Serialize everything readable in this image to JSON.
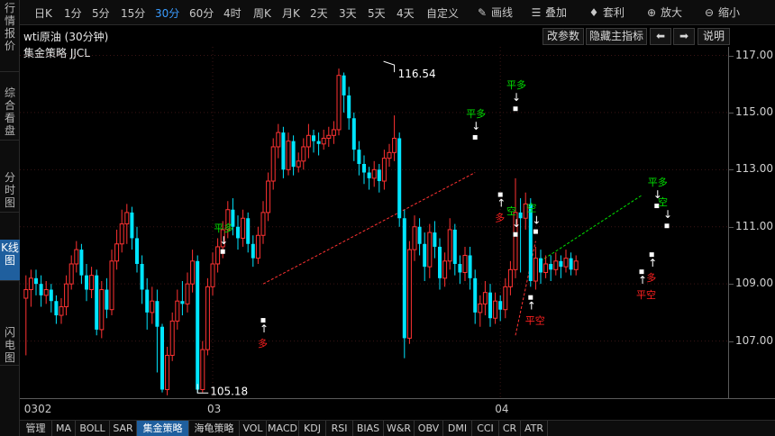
{
  "left_nav": {
    "tabs": [
      {
        "label": "行情报价",
        "active": false
      },
      {
        "label": "综合看盘",
        "active": false
      },
      {
        "label": "分时图",
        "active": false
      },
      {
        "label": "K线图",
        "active": true
      },
      {
        "label": "闪电图",
        "active": false
      }
    ]
  },
  "toolbar": {
    "periods": [
      "日K",
      "1分",
      "5分",
      "15分",
      "30分",
      "60分",
      "4时",
      "周K",
      "月K",
      "2天",
      "3天",
      "5天",
      "4天",
      "自定义"
    ],
    "active_period": "30分",
    "tools": [
      {
        "label": "画线",
        "icon": "pencil-icon"
      },
      {
        "label": "叠加",
        "icon": "database-icon"
      },
      {
        "label": "套利",
        "icon": "money-bag-icon"
      },
      {
        "label": "放大",
        "icon": "zoom-in-icon"
      },
      {
        "label": "缩小",
        "icon": "zoom-out-icon"
      }
    ]
  },
  "chart_header": {
    "title": "wti原油 (30分钟)",
    "strategy": "集金策略 JJCL",
    "buttons": {
      "params": "改参数",
      "hide_indicator": "隐藏主指标",
      "prev": "⬅",
      "next": "➡",
      "help": "说明"
    }
  },
  "colors": {
    "up": "#ff3232",
    "down": "#00e5ff",
    "signal_flat": "#00e000",
    "signal_short": "#00e000",
    "signal_long": "#ff2020",
    "active_tab": "#1f5f9e"
  },
  "chart_data": {
    "type": "candlestick",
    "ylim": [
      105.0,
      117.3
    ],
    "price_ticks": [
      "117.00",
      "115.00",
      "113.00",
      "111.00",
      "109.00",
      "107.00"
    ],
    "price_tick_values": [
      117,
      115,
      113,
      111,
      109,
      107
    ],
    "date_labels": [
      {
        "label": "0302",
        "index": 0
      },
      {
        "label": "03",
        "index": 37
      },
      {
        "label": "04",
        "index": 94
      }
    ],
    "annotations": {
      "high_label": "116.54",
      "high_index": 73,
      "high_value": 116.54,
      "low_label": "105.18",
      "low_index": 34,
      "low_value": 105.18
    },
    "candles": [
      [
        108.5,
        108.8,
        106.5,
        109.3
      ],
      [
        108.8,
        109.2,
        108.2,
        109.5
      ],
      [
        109.2,
        109.0,
        108.6,
        109.5
      ],
      [
        109.0,
        108.6,
        108.2,
        109.3
      ],
      [
        108.6,
        108.8,
        108.3,
        109.1
      ],
      [
        108.8,
        108.4,
        108.0,
        109.0
      ],
      [
        108.4,
        107.9,
        107.6,
        108.6
      ],
      [
        107.9,
        108.2,
        107.6,
        108.5
      ],
      [
        108.2,
        109.0,
        107.9,
        109.3
      ],
      [
        109.0,
        109.7,
        108.8,
        110.0
      ],
      [
        109.7,
        110.2,
        109.4,
        110.5
      ],
      [
        110.2,
        109.3,
        109.0,
        110.4
      ],
      [
        109.3,
        108.8,
        108.4,
        109.7
      ],
      [
        108.8,
        109.3,
        108.5,
        109.6
      ],
      [
        109.3,
        107.4,
        107.2,
        109.5
      ],
      [
        107.4,
        108.8,
        107.1,
        109.1
      ],
      [
        108.8,
        108.1,
        107.8,
        109.2
      ],
      [
        108.1,
        109.8,
        107.9,
        110.2
      ],
      [
        109.8,
        110.4,
        109.5,
        110.9
      ],
      [
        110.4,
        111.1,
        110.1,
        111.6
      ],
      [
        111.1,
        111.5,
        110.4,
        111.8
      ],
      [
        111.5,
        110.6,
        110.2,
        111.7
      ],
      [
        110.6,
        109.7,
        109.4,
        111.0
      ],
      [
        109.7,
        108.8,
        108.3,
        110.0
      ],
      [
        108.8,
        108.0,
        107.4,
        109.2
      ],
      [
        108.0,
        108.4,
        107.6,
        108.9
      ],
      [
        108.4,
        107.5,
        105.9,
        108.8
      ],
      [
        107.5,
        105.3,
        105.2,
        107.6
      ],
      [
        105.3,
        106.5,
        105.1,
        106.8
      ],
      [
        106.5,
        107.7,
        106.3,
        108.0
      ],
      [
        107.7,
        108.4,
        107.4,
        108.8
      ],
      [
        108.4,
        108.3,
        107.9,
        109.1
      ],
      [
        108.3,
        109.0,
        108.0,
        109.4
      ],
      [
        109.0,
        109.8,
        108.7,
        110.2
      ],
      [
        109.8,
        105.3,
        105.18,
        110.0
      ],
      [
        105.3,
        106.7,
        105.2,
        107.0
      ],
      [
        106.7,
        108.9,
        106.5,
        109.2
      ],
      [
        108.9,
        109.7,
        108.6,
        110.1
      ],
      [
        109.7,
        110.3,
        109.4,
        110.6
      ],
      [
        110.3,
        110.9,
        109.9,
        111.2
      ],
      [
        110.9,
        111.6,
        110.6,
        111.9
      ],
      [
        111.6,
        111.0,
        110.7,
        112.0
      ],
      [
        111.0,
        110.6,
        110.2,
        111.4
      ],
      [
        110.6,
        111.3,
        110.3,
        111.6
      ],
      [
        111.3,
        110.4,
        110.1,
        111.5
      ],
      [
        110.4,
        109.9,
        109.6,
        110.7
      ],
      [
        109.9,
        110.7,
        109.7,
        111.0
      ],
      [
        110.7,
        111.5,
        110.4,
        111.9
      ],
      [
        111.5,
        112.6,
        111.2,
        112.9
      ],
      [
        112.6,
        113.8,
        112.3,
        114.1
      ],
      [
        113.8,
        114.3,
        113.4,
        114.6
      ],
      [
        114.3,
        113.0,
        112.7,
        114.5
      ],
      [
        113.0,
        114.0,
        112.8,
        114.3
      ],
      [
        114.0,
        113.1,
        112.8,
        114.2
      ],
      [
        113.1,
        113.3,
        112.9,
        113.6
      ],
      [
        113.3,
        113.8,
        113.0,
        114.1
      ],
      [
        113.8,
        114.2,
        113.4,
        114.6
      ],
      [
        114.2,
        114.0,
        113.6,
        114.4
      ],
      [
        114.0,
        113.9,
        113.5,
        114.3
      ],
      [
        113.9,
        114.1,
        113.7,
        114.4
      ],
      [
        114.1,
        114.2,
        113.8,
        114.5
      ],
      [
        114.2,
        114.4,
        113.9,
        114.7
      ],
      [
        114.4,
        116.3,
        114.2,
        116.54
      ],
      [
        116.3,
        115.6,
        115.0,
        116.4
      ],
      [
        115.6,
        114.8,
        114.4,
        115.9
      ],
      [
        114.8,
        113.7,
        113.3,
        115.0
      ],
      [
        113.7,
        113.2,
        112.8,
        114.0
      ],
      [
        113.2,
        112.9,
        112.5,
        113.5
      ],
      [
        112.9,
        112.7,
        112.3,
        113.1
      ],
      [
        112.7,
        113.0,
        112.4,
        113.3
      ],
      [
        113.0,
        112.6,
        112.2,
        113.2
      ],
      [
        112.6,
        113.4,
        112.3,
        113.7
      ],
      [
        113.4,
        113.6,
        113.1,
        113.9
      ],
      [
        113.6,
        114.1,
        113.3,
        114.9
      ],
      [
        114.1,
        111.3,
        111.0,
        114.3
      ],
      [
        111.3,
        107.1,
        106.4,
        111.6
      ],
      [
        107.1,
        110.2,
        106.9,
        110.5
      ],
      [
        110.2,
        111.0,
        109.8,
        111.4
      ],
      [
        111.0,
        110.4,
        110.0,
        111.3
      ],
      [
        110.4,
        109.6,
        109.1,
        110.8
      ],
      [
        109.6,
        110.8,
        109.2,
        111.1
      ],
      [
        110.8,
        110.3,
        109.9,
        111.2
      ],
      [
        110.3,
        109.2,
        108.8,
        110.6
      ],
      [
        109.2,
        109.8,
        108.9,
        110.1
      ],
      [
        109.8,
        110.9,
        109.5,
        111.3
      ],
      [
        110.9,
        109.7,
        109.3,
        111.1
      ],
      [
        109.7,
        109.4,
        109.0,
        110.0
      ],
      [
        109.4,
        110.0,
        109.1,
        110.3
      ],
      [
        110.0,
        109.2,
        108.8,
        110.3
      ],
      [
        109.2,
        108.0,
        107.6,
        109.5
      ],
      [
        108.0,
        108.3,
        107.5,
        108.6
      ],
      [
        108.3,
        108.7,
        107.9,
        109.1
      ],
      [
        108.7,
        107.8,
        107.5,
        109.0
      ],
      [
        107.8,
        108.4,
        107.6,
        108.7
      ],
      [
        108.4,
        108.1,
        107.7,
        108.6
      ],
      [
        108.1,
        108.9,
        107.8,
        109.2
      ],
      [
        108.9,
        109.5,
        108.6,
        109.8
      ],
      [
        109.5,
        111.5,
        109.2,
        112.7
      ],
      [
        111.5,
        111.3,
        109.4,
        112.0
      ],
      [
        111.3,
        111.8,
        110.9,
        112.2
      ],
      [
        111.8,
        109.1,
        108.9,
        112.0
      ],
      [
        109.1,
        109.9,
        108.8,
        110.3
      ],
      [
        109.9,
        109.4,
        109.0,
        110.2
      ],
      [
        109.4,
        109.7,
        109.2,
        110.0
      ],
      [
        109.7,
        109.5,
        109.1,
        110.0
      ],
      [
        109.5,
        109.8,
        109.3,
        110.1
      ],
      [
        109.8,
        109.6,
        109.2,
        110.0
      ],
      [
        109.6,
        109.9,
        109.4,
        110.2
      ],
      [
        109.9,
        109.5,
        109.3,
        110.1
      ],
      [
        109.5,
        109.8,
        109.3,
        110.0
      ]
    ],
    "signals": [
      {
        "label": "平多",
        "index": 39,
        "value": 110.4,
        "kind": "flat",
        "arrow": "down"
      },
      {
        "label": "多",
        "index": 47,
        "value": 107.3,
        "kind": "long",
        "arrow": "up"
      },
      {
        "label": "平多",
        "index": 97,
        "value": 115.4,
        "kind": "flat",
        "arrow": "down"
      },
      {
        "label": "平多",
        "index": 89,
        "value": 114.4,
        "kind": "flat",
        "arrow": "down"
      },
      {
        "label": "多",
        "index": 94,
        "value": 111.7,
        "kind": "long",
        "arrow": "up"
      },
      {
        "label": "空",
        "index": 97,
        "value": 111.0,
        "kind": "short",
        "arrow": "down"
      },
      {
        "label": "空",
        "index": 101,
        "value": 111.1,
        "kind": "short",
        "arrow": "down"
      },
      {
        "label": "平空",
        "index": 100,
        "value": 108.1,
        "kind": "long",
        "arrow": "up"
      },
      {
        "label": "平多",
        "index": 125,
        "value": 112.0,
        "kind": "flat",
        "arrow": "down"
      },
      {
        "label": "空",
        "index": 127,
        "value": 111.3,
        "kind": "short",
        "arrow": "down"
      },
      {
        "label": "平空",
        "index": 122,
        "value": 109.0,
        "kind": "long",
        "arrow": "up"
      },
      {
        "label": "多",
        "index": 124,
        "value": 109.6,
        "kind": "long",
        "arrow": "up"
      }
    ],
    "trade_lines": [
      {
        "from_index": 47,
        "from_value": 109.0,
        "to_index": 89,
        "to_value": 112.9,
        "color": "#ff3232"
      },
      {
        "from_index": 97,
        "from_value": 107.2,
        "to_index": 101,
        "to_value": 110.5,
        "color": "#ff3232"
      },
      {
        "from_index": 102,
        "from_value": 109.8,
        "to_index": 122,
        "to_value": 112.1,
        "color": "#00e000"
      }
    ]
  },
  "bottom_tabs": {
    "items": [
      "管理",
      "MA",
      "BOLL",
      "SAR",
      "集金策略",
      "海龟策略",
      "VOL",
      "MACD",
      "KDJ",
      "RSI",
      "BIAS",
      "W&R",
      "OBV",
      "DMI",
      "CCI",
      "CR",
      "ATR"
    ],
    "active": "集金策略"
  }
}
